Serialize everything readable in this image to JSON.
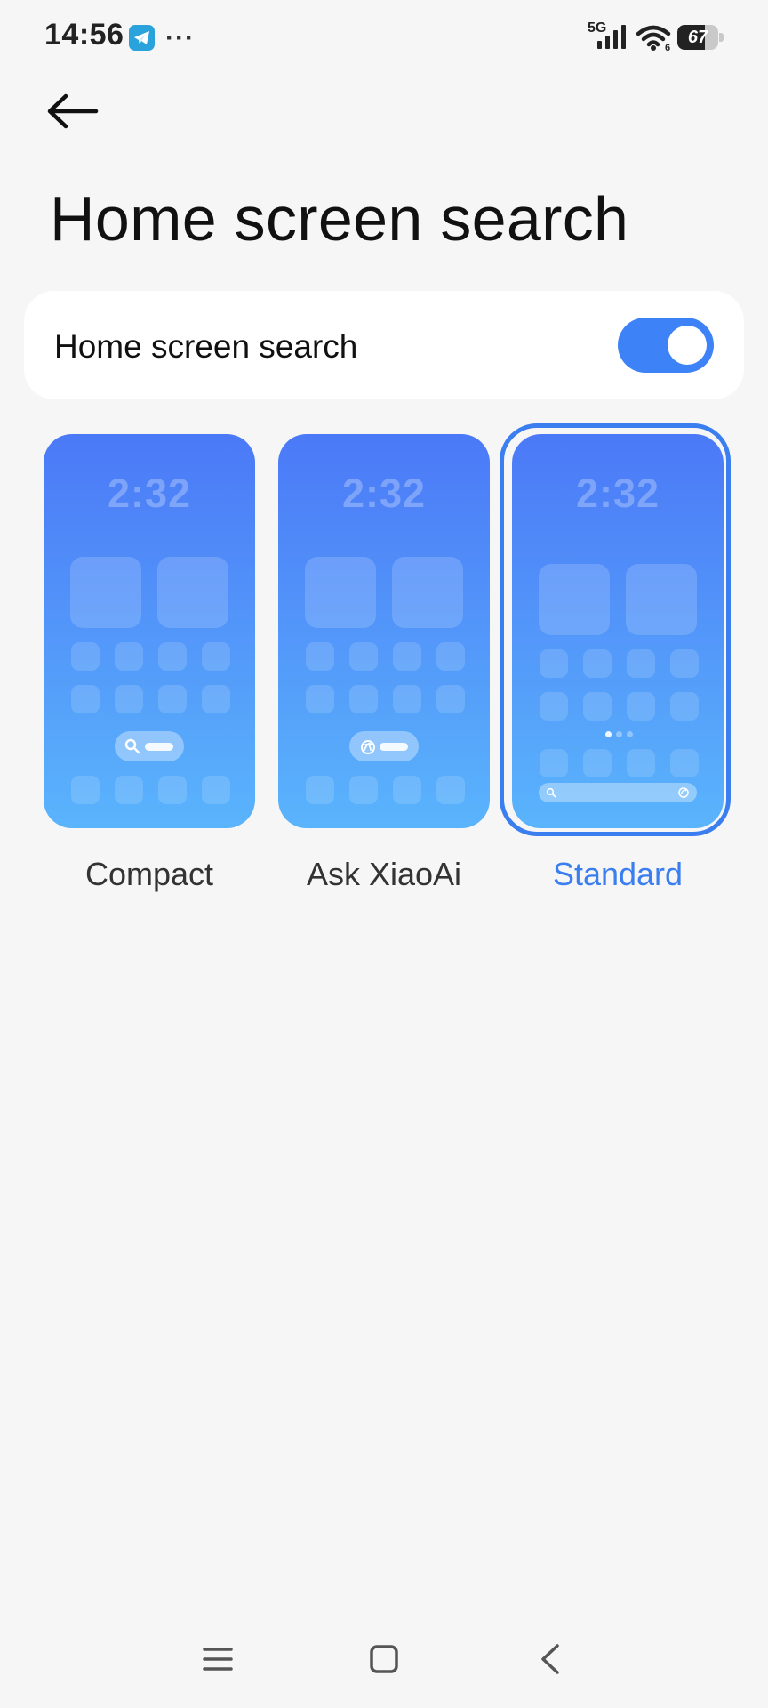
{
  "status_bar": {
    "time": "14:56",
    "network": "5G",
    "battery_level": 67,
    "battery_text": "67",
    "icons": [
      "telegram-icon",
      "more-icon",
      "signal-icon",
      "wifi-icon",
      "battery-icon"
    ]
  },
  "header": {
    "back_icon": "arrow-left-icon",
    "title": "Home screen search"
  },
  "toggle": {
    "label": "Home screen search",
    "enabled": true
  },
  "options": [
    {
      "label": "Compact",
      "preview_clock": "2:32",
      "selected": false,
      "pill_icon": "search-icon"
    },
    {
      "label": "Ask XiaoAi",
      "preview_clock": "2:32",
      "selected": false,
      "pill_icon": "xiaoai-icon"
    },
    {
      "label": "Standard",
      "preview_clock": "2:32",
      "selected": true,
      "pill_icon": "search-icon"
    }
  ],
  "colors": {
    "accent": "#3b7ef0",
    "toggle_on": "#3d82f6",
    "background": "#f6f6f6",
    "preview_top": "#4b79f7",
    "preview_bottom": "#5ab4fc"
  },
  "nav_bar": {
    "icons": [
      "menu-icon",
      "home-icon",
      "back-icon"
    ]
  }
}
